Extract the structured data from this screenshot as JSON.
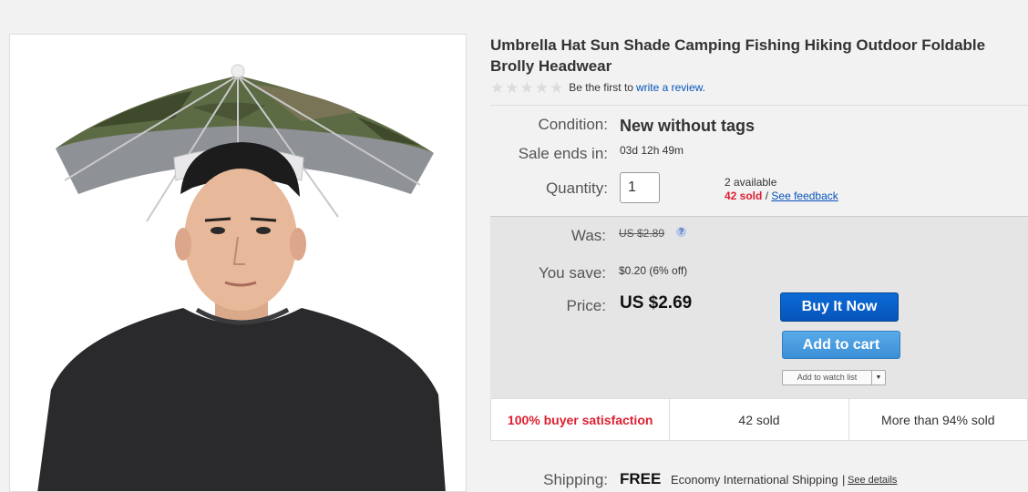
{
  "product": {
    "title": "Umbrella Hat Sun Shade Camping Fishing Hiking Outdoor Foldable Brolly Headwear",
    "image_alt": "Man wearing camouflage umbrella hat"
  },
  "rating": {
    "stars_filled": 0,
    "stars_total": 5,
    "prompt": "Be the first to",
    "link": "write a review."
  },
  "details": {
    "condition_label": "Condition:",
    "condition_value": "New without tags",
    "sale_label": "Sale ends in:",
    "sale_value": "03d 12h 49m",
    "quantity_label": "Quantity:",
    "quantity_value": "1",
    "available": "2 available",
    "sold": "42 sold",
    "separator": "/",
    "feedback_link": "See feedback"
  },
  "pricing": {
    "was_label": "Was:",
    "was_value": "US $2.89",
    "help_glyph": "?",
    "save_label": "You save:",
    "save_value": "$0.20 (6% off)",
    "price_label": "Price:",
    "price_value": "US $2.69"
  },
  "actions": {
    "buy_now": "Buy It Now",
    "add_to_cart": "Add to cart",
    "watch_list": "Add to watch list",
    "watch_arrow": "▼"
  },
  "stats": {
    "satisfaction": "100% buyer satisfaction",
    "sold": "42 sold",
    "sold_percent": "More than 94% sold"
  },
  "shipping": {
    "label": "Shipping:",
    "cost": "FREE",
    "method": "Economy International Shipping",
    "separator": "|",
    "details_link": "See details"
  },
  "colors": {
    "primary_button": "#0654ba",
    "secondary_button": "#3b8fd6",
    "sold_red": "#dd1e31",
    "link_blue": "#0654ba"
  }
}
